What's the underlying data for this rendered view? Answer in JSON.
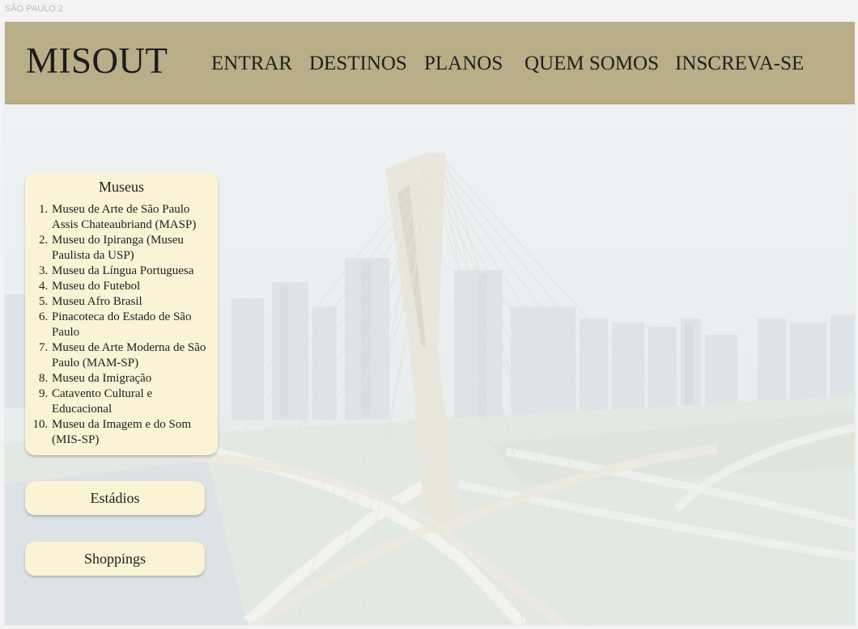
{
  "frame_label": "SÃO PAULO 2",
  "header": {
    "logo": "MISOUT",
    "nav": [
      {
        "label": "ENTRAR"
      },
      {
        "label": "DESTINOS"
      },
      {
        "label": "PLANOS"
      },
      {
        "label": "QUEM SOMOS"
      },
      {
        "label": "INSCREVA-SE"
      }
    ]
  },
  "hero": {
    "image": "bridge-skyline"
  },
  "museus": {
    "title": "Museus",
    "items": [
      "Museu de Arte de São Paulo Assis Chateaubriand (MASP)",
      "Museu do Ipiranga (Museu Paulista da USP)",
      "Museu da Língua Portuguesa",
      "Museu do Futebol",
      "Museu Afro Brasil",
      "Pinacoteca do Estado de São Paulo",
      "Museu de Arte Moderna de São Paulo (MAM-SP)",
      "Museu da Imigração",
      "Catavento Cultural e Educacional",
      "Museu da Imagem e do Som (MIS-SP)"
    ]
  },
  "estadios": {
    "label": "Estádios"
  },
  "shoppings": {
    "label": "Shoppings"
  },
  "colors": {
    "header_bg": "#b8ae88",
    "card_bg": "#faf3d6",
    "text": "#1e1e1e"
  }
}
